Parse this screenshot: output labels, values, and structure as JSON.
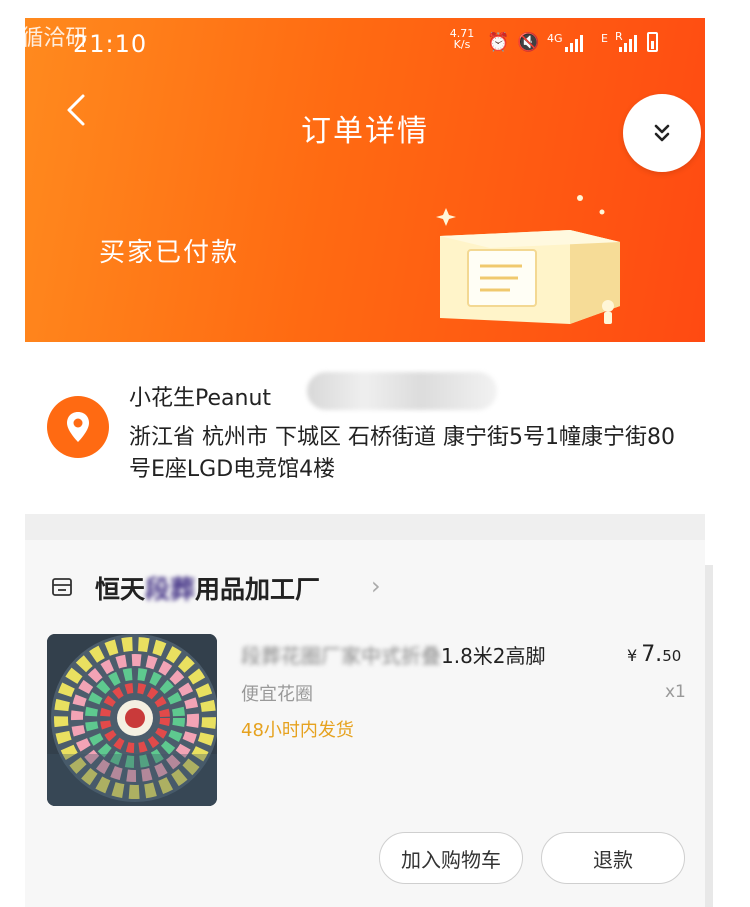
{
  "status_bar": {
    "watermark": "←循洽研",
    "time": "21:10",
    "net_speed": "4.71",
    "net_unit": "K/s",
    "network_4g": "4G",
    "network_e": "E",
    "network_r": "R"
  },
  "header": {
    "title": "订单详情",
    "order_status": "买家已付款"
  },
  "address": {
    "recipient": "小花生Peanut",
    "full_address": "浙江省 杭州市 下城区 石桥街道 康宁街5号1幢康宁街80号E座LGD电竞馆4楼"
  },
  "shop": {
    "name_prefix": "恒天",
    "name_blurred": "段葬",
    "name_suffix": "用品加工厂",
    "arrow": "›"
  },
  "product": {
    "title_blurred": "段葬花圈厂家中式折叠",
    "title_visible": "1.8米2高脚",
    "price_currency": "¥",
    "price_int": "7.",
    "price_dec": "50",
    "spec": "便宜花圈",
    "quantity": "x1",
    "delivery": "48小时内发货"
  },
  "actions": {
    "add_to_cart": "加入购物车",
    "refund": "退款"
  },
  "colors": {
    "header_start": "#ff8a1e",
    "header_end": "#ff4a12",
    "accent": "#ff6a12",
    "delivery_text": "#e6a21f"
  }
}
